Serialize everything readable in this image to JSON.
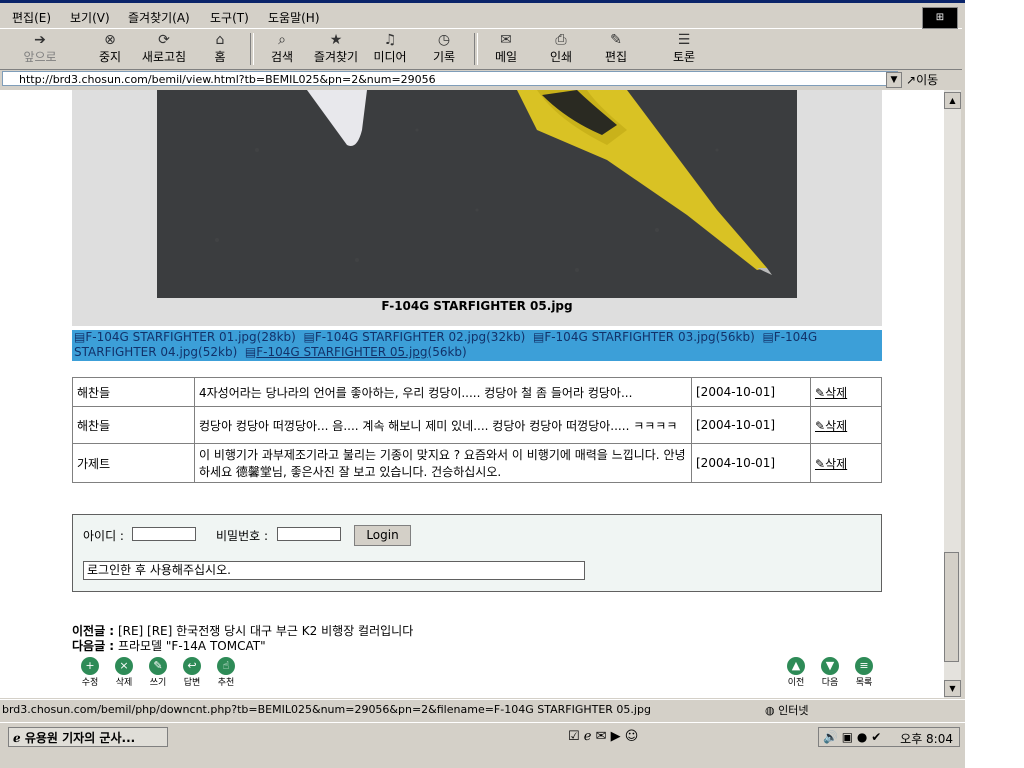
{
  "menu": [
    "편집(E)",
    "보기(V)",
    "즐겨찾기(A)",
    "도구(T)",
    "도움말(H)"
  ],
  "toolbar": {
    "back": "앞으로",
    "stop": "중지",
    "refresh": "새로고침",
    "home": "홈",
    "search": "검색",
    "favorites": "즐겨찾기",
    "media": "미디어",
    "history": "기록",
    "mail": "메일",
    "print": "인쇄",
    "edit": "편집",
    "discuss": "토론"
  },
  "address": {
    "url": "http://brd3.chosun.com/bemil/view.html?tb=BEMIL025&pn=2&num=29056",
    "go": "이동"
  },
  "photo": {
    "caption": "F-104G STARFIGHTER 05.jpg"
  },
  "attachments": [
    {
      "name": "F-104G STARFIGHTER 01.jpg",
      "size": "(28kb)"
    },
    {
      "name": "F-104G STARFIGHTER 02.jpg",
      "size": "(32kb)"
    },
    {
      "name": "F-104G STARFIGHTER 03.jpg",
      "size": "(56kb)"
    },
    {
      "name": "F-104G STARFIGHTER 04.jpg",
      "size": "(52kb)"
    },
    {
      "name": "F-104G STARFIGHTER 05.jpg",
      "size": "(56kb)"
    }
  ],
  "comments": [
    {
      "author": "해찬들",
      "text": "4자성어라는 당나라의 언어를 좋아하는, 우리 컹당이..... 컹당아 철 좀 들어라 컹당아...",
      "date": "[2004-10-01]",
      "delete": "삭제"
    },
    {
      "author": "해찬들",
      "text": "컹당아 컹당아 떠껑당아... 음.... 계속 해보니 제미 있네.... 컹당아 컹당아 떠껑당아..... ㅋㅋㅋㅋ",
      "date": "[2004-10-01]",
      "delete": "삭제"
    },
    {
      "author": "가제트",
      "text": "이 비행기가 과부제조기라고 불리는 기종이 맞지요 ? 요즘와서 이 비행기에 매력을 느낍니다. 안녕하세요 德馨堂님, 좋은사진 잘 보고 있습니다. 건승하십시오.",
      "date": "[2004-10-01]",
      "delete": "삭제"
    }
  ],
  "login": {
    "id_label": "아이디 :",
    "pw_label": "비밀번호 :",
    "button": "Login",
    "comment_placeholder": "로그인한 후 사용해주십시오."
  },
  "navigation": {
    "prev_label": "이전글 :",
    "prev_title": "[RE] [RE] 한국전쟁 당시 대구 부근 K2 비행장 컬러입니다",
    "next_label": "다음글 :",
    "next_title": "프라모델 \"F-14A TOMCAT\""
  },
  "actions_left": [
    {
      "label": "수정",
      "icon": "plus-icon",
      "glyph": "+"
    },
    {
      "label": "삭제",
      "icon": "x-icon",
      "glyph": "×"
    },
    {
      "label": "쓰기",
      "icon": "pencil-icon",
      "glyph": "✎"
    },
    {
      "label": "답변",
      "icon": "reply-icon",
      "glyph": "↩"
    },
    {
      "label": "추천",
      "icon": "thumb-icon",
      "glyph": "☝"
    }
  ],
  "actions_right": [
    {
      "label": "이전",
      "icon": "up-icon",
      "glyph": "▲"
    },
    {
      "label": "다음",
      "icon": "down-icon",
      "glyph": "▼"
    },
    {
      "label": "목록",
      "icon": "list-icon",
      "glyph": "≡"
    }
  ],
  "status": {
    "text": "brd3.chosun.com/bemil/php/downcnt.php?tb=BEMIL025&num=29056&pn=2&filename=F-104G STARFIGHTER 05.jpg",
    "zone": "인터넷"
  },
  "taskbar": {
    "window": "유용원 기자의 군사...",
    "clock": "오후 8:04"
  },
  "colors": {
    "chrome": "#d4d0c8",
    "attach_bar": "#3c9fd8",
    "plane_yellow": "#d9c224"
  }
}
